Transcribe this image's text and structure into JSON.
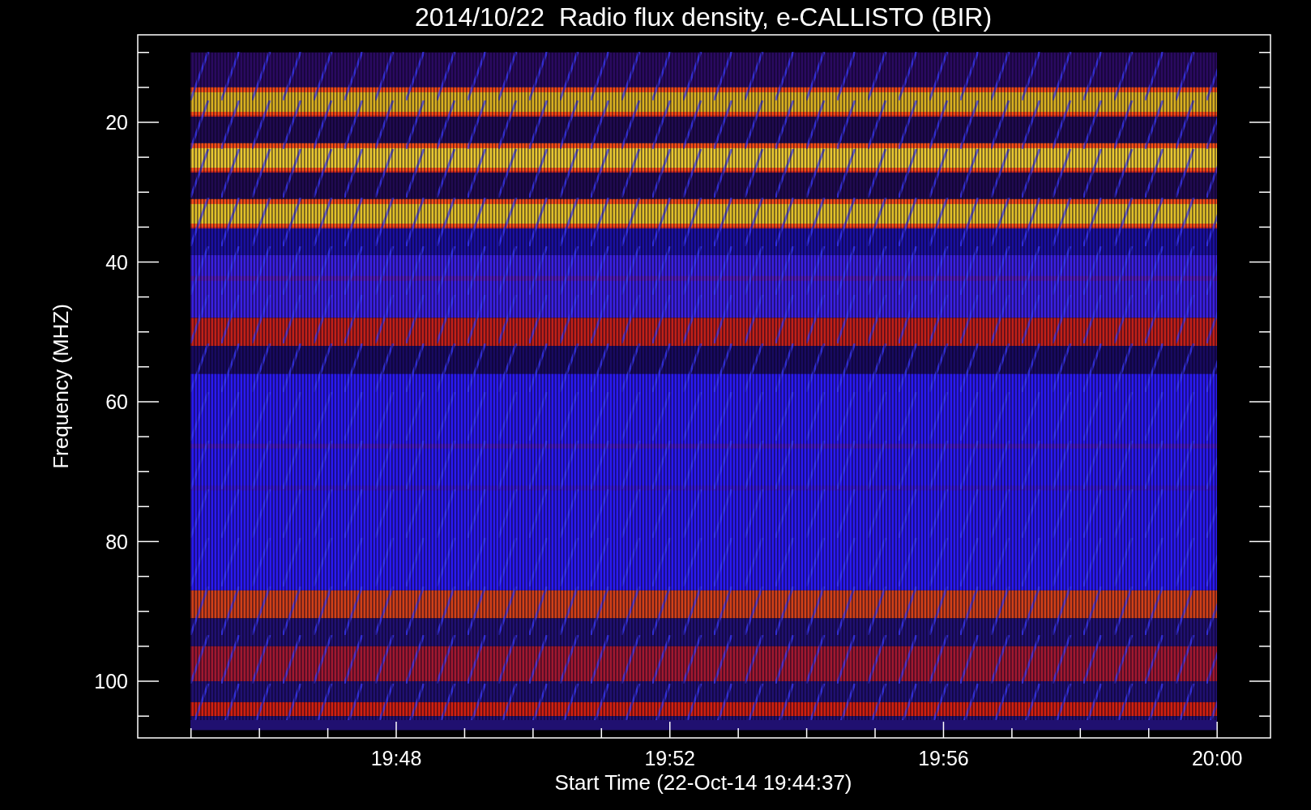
{
  "title": "2014/10/22  Radio flux density, e-CALLISTO (BIR)",
  "y_axis": {
    "label": "Frequency (MHZ)",
    "ticks": [
      "20",
      "40",
      "60",
      "80",
      "100"
    ]
  },
  "x_axis": {
    "label": "Start Time (22-Oct-14 19:44:37)",
    "ticks": [
      "19:48",
      "19:52",
      "19:56",
      "20:00"
    ]
  }
}
